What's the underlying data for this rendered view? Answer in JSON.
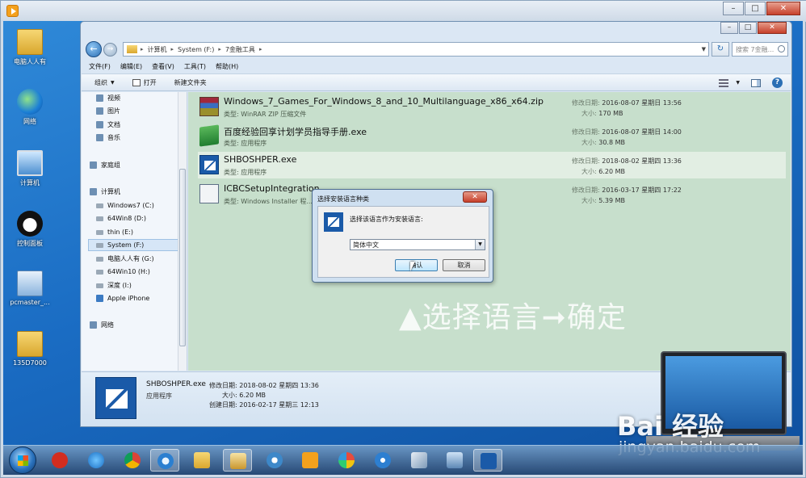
{
  "colors": {
    "accent": "#1a5aa8",
    "file_area": "#c7dfcc",
    "desktop": "#1a6cc3"
  },
  "desktop_icons": [
    {
      "label": "电脑人人有",
      "icon": "folder-icon"
    },
    {
      "label": "网络",
      "icon": "network-icon"
    },
    {
      "label": "计算机",
      "icon": "computer-icon"
    },
    {
      "label": "控制面板",
      "icon": "control-panel-icon"
    },
    {
      "label": "pcmaster_...",
      "icon": "pcmaster-icon"
    },
    {
      "label": "135D7000",
      "icon": "folder-icon"
    }
  ],
  "explorer": {
    "breadcrumbs": [
      "计算机",
      "System (F:)",
      "7金融工具"
    ],
    "search_placeholder": "搜索 7金融...",
    "menu": [
      "文件(F)",
      "编辑(E)",
      "查看(V)",
      "工具(T)",
      "帮助(H)"
    ],
    "toolbar": {
      "organize": "组织",
      "open": "打开",
      "new_folder": "新建文件夹"
    },
    "nav": [
      {
        "label": "视频",
        "icon": "video-icon"
      },
      {
        "label": "图片",
        "icon": "picture-icon"
      },
      {
        "label": "文档",
        "icon": "document-icon"
      },
      {
        "label": "音乐",
        "icon": "music-icon"
      },
      {
        "label": "家庭组",
        "icon": "homegroup-icon"
      },
      {
        "label": "计算机",
        "icon": "computer-icon"
      },
      {
        "label": "Windows7 (C:)",
        "icon": "drive-icon"
      },
      {
        "label": "64Win8  (D:)",
        "icon": "drive-icon"
      },
      {
        "label": "thin (E:)",
        "icon": "drive-icon"
      },
      {
        "label": "System (F:)",
        "icon": "drive-icon",
        "selected": true
      },
      {
        "label": "电脑人人有 (G:)",
        "icon": "drive-icon"
      },
      {
        "label": "64Win10 (H:)",
        "icon": "drive-icon"
      },
      {
        "label": "深度 (I:)",
        "icon": "drive-icon"
      },
      {
        "label": "Apple iPhone",
        "icon": "phone-icon"
      },
      {
        "label": "网络",
        "icon": "network-icon"
      }
    ],
    "files": [
      {
        "name": "Windows_7_Games_For_Windows_8_and_10_Multilanguage_x86_x64.zip",
        "type": "类型: WinRAR ZIP 压缩文件",
        "modified_label": "修改日期:",
        "modified": "2016-08-07 星期日 13:56",
        "size_label": "大小:",
        "size": "170 MB",
        "icon": "winrar-icon"
      },
      {
        "name": "百度经验回享计划学员指导手册.exe",
        "type": "类型: 应用程序",
        "modified_label": "修改日期:",
        "modified": "2016-08-07 星期日 14:00",
        "size_label": "大小:",
        "size": "30.8 MB",
        "icon": "book-icon"
      },
      {
        "name": "SHBOSHPER.exe",
        "type": "类型: 应用程序",
        "modified_label": "修改日期:",
        "modified": "2018-08-02 星期四 13:36",
        "size_label": "大小:",
        "size": "6.20 MB",
        "icon": "shboshper-icon",
        "selected": true
      },
      {
        "name": "ICBCSetupIntegration",
        "type": "类型: Windows Installer 程...",
        "modified_label": "修改日期:",
        "modified": "2016-03-17 星期四 17:22",
        "size_label": "大小:",
        "size": "5.39 MB",
        "icon": "installer-icon"
      }
    ],
    "details": {
      "name": "SHBOSHPER.exe",
      "type": "应用程序",
      "modified_line": "修改日期: 2018-08-02 星期四 13:36",
      "size_line": "大小: 6.20 MB",
      "created_line": "创建日期: 2016-02-17 星期三 12:13"
    }
  },
  "dialog": {
    "title": "选择安装语言种类",
    "prompt": "选择该语言作为安装语言:",
    "selected_language": "简体中文",
    "ok_label": "确认",
    "cancel_label": "取消"
  },
  "caption": "▲选择语言➞确定",
  "watermark": {
    "logo": "Bai 经验",
    "url": "jingyan.baidu.com"
  },
  "taskbar_items": [
    {
      "icon": "chess-icon"
    },
    {
      "icon": "ie-icon"
    },
    {
      "icon": "chrome-icon"
    },
    {
      "icon": "search-app-icon",
      "active": true
    },
    {
      "icon": "folder-icon"
    },
    {
      "icon": "explorer-icon"
    },
    {
      "icon": "flower-icon"
    },
    {
      "icon": "player-icon"
    },
    {
      "icon": "paint-icon"
    },
    {
      "icon": "network-app-icon"
    },
    {
      "icon": "box-icon"
    },
    {
      "icon": "monitor-icon"
    },
    {
      "icon": "shboshper-icon",
      "active": true
    }
  ]
}
